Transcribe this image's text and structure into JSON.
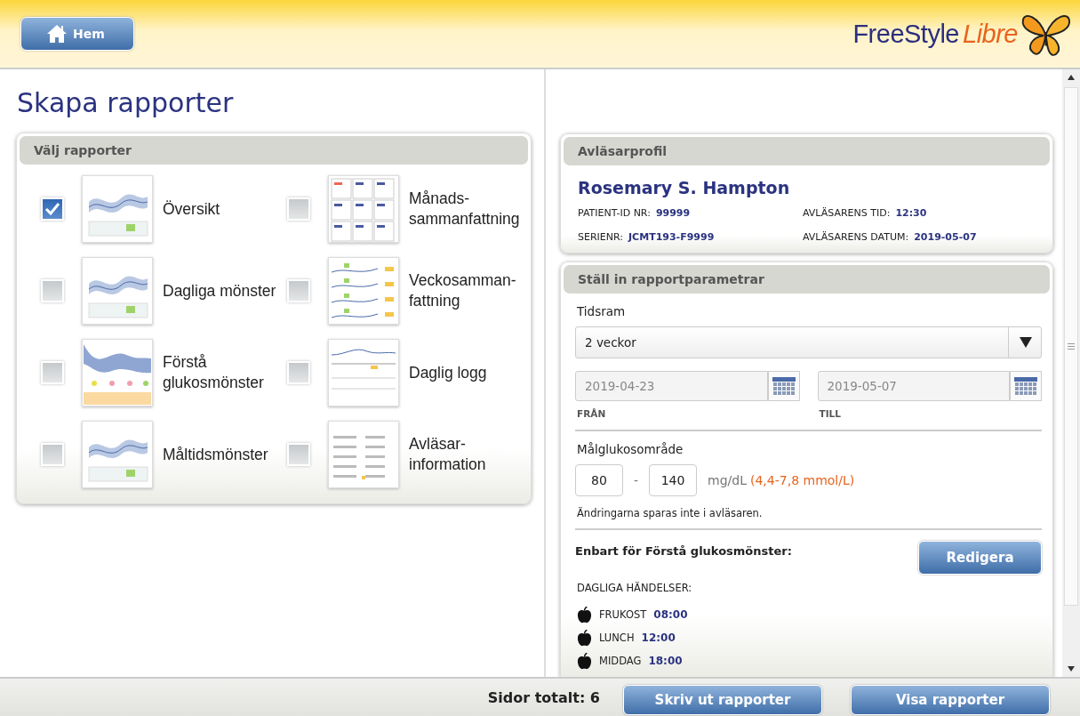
{
  "header": {
    "home_button": "Hem",
    "logo": {
      "text": "FreeStyle",
      "accent": "Libre"
    }
  },
  "page_title": "Skapa rapporter",
  "reports_panel": {
    "title": "Välj rapporter",
    "reports": [
      {
        "label": "Översikt",
        "checked": true,
        "kind": "chart"
      },
      {
        "label": "Dagliga mönster",
        "checked": false,
        "kind": "chart"
      },
      {
        "label": "Förstå glukosmönster",
        "checked": false,
        "kind": "band"
      },
      {
        "label": "Måltidsmönster",
        "checked": false,
        "kind": "chart"
      },
      {
        "label": "Månads-sammanfattning",
        "checked": false,
        "kind": "grid"
      },
      {
        "label": "Veckosamman-fattning",
        "checked": false,
        "kind": "weeks"
      },
      {
        "label": "Daglig logg",
        "checked": false,
        "kind": "log"
      },
      {
        "label": "Avläsar-information",
        "checked": false,
        "kind": "text"
      }
    ]
  },
  "profile": {
    "title": "Avläsarprofil",
    "name": "Rosemary S. Hampton",
    "fields": [
      {
        "label": "PATIENT-ID NR:",
        "value": "99999"
      },
      {
        "label": "AVLÄSARENS TID:",
        "value": "12:30"
      },
      {
        "label": "SERIENR:",
        "value": "JCMT193-F9999"
      },
      {
        "label": "AVLÄSARENS DATUM:",
        "value": "2019-05-07"
      }
    ]
  },
  "params": {
    "title": "Ställ in rapportparametrar",
    "timeframe": {
      "label": "Tidsram",
      "value": "2 veckor"
    },
    "dates": [
      {
        "value": "2019-04-23",
        "label": "FRÅN",
        "disabled": true
      },
      {
        "value": "2019-05-07",
        "label": "TILL",
        "disabled": true
      }
    ],
    "target": {
      "label": "Målglukosområde",
      "low": "80",
      "separator": "-",
      "high": "140",
      "unit": "mg/dL",
      "mmol": "(4,4-7,8 mmol/L)"
    },
    "note": "Ändringarna sparas inte i avläsaren.",
    "section": {
      "title": "Enbart för Förstå glukosmönster:",
      "button": "Redigera",
      "events_label": "DAGLIGA HÄNDELSER:",
      "events": [
        {
          "name": "FRUKOST",
          "time": "08:00"
        },
        {
          "name": "LUNCH",
          "time": "12:00"
        },
        {
          "name": "MIDDAG",
          "time": "18:00"
        }
      ]
    }
  },
  "footer": {
    "pages_label": "Sidor totalt: 6",
    "buttons": [
      "Skriv ut rapporter",
      "Visa rapporter"
    ]
  }
}
